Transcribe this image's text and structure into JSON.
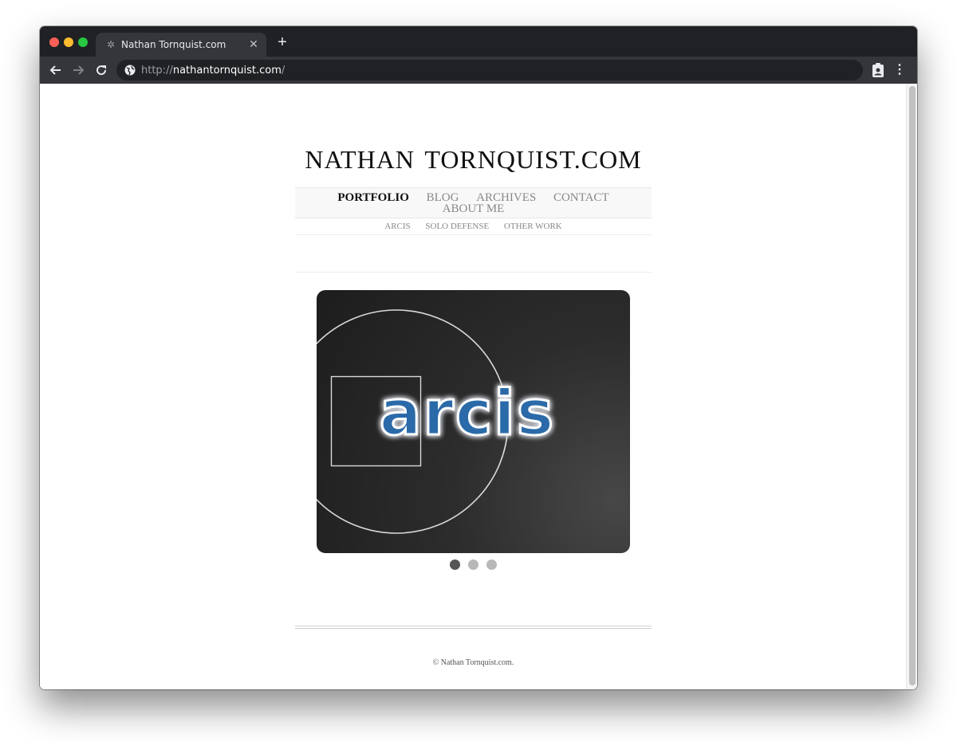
{
  "browser": {
    "tab_title": "Nathan Tornquist.com",
    "url_scheme": "http://",
    "url_host": "nathantornquist.com",
    "url_path": "/",
    "icons": {
      "back": "arrow-left",
      "forward": "arrow-right",
      "reload": "reload",
      "site_info": "globe",
      "extension": "clipboard-person",
      "menu": "three-dots-vertical",
      "new_tab": "plus",
      "close_tab": "x"
    }
  },
  "site": {
    "title": "NATHAN TORNQUIST.COM",
    "nav": {
      "items": [
        {
          "label": "PORTFOLIO",
          "active": true
        },
        {
          "label": "BLOG",
          "active": false
        },
        {
          "label": "ARCHIVES",
          "active": false
        },
        {
          "label": "CONTACT",
          "active": false
        },
        {
          "label": "ABOUT ME",
          "active": false
        }
      ]
    },
    "subnav": {
      "items": [
        "ARCIS",
        "SOLO DEFENSE",
        "OTHER WORK"
      ]
    },
    "slider": {
      "logo_text": "arcis",
      "slide_count": 3,
      "active_slide": 1,
      "logo_color": "#2a6aa8",
      "glow_color": "#7ec8ff"
    },
    "footer": {
      "copyright": "© Nathan Tornquist.com."
    }
  }
}
